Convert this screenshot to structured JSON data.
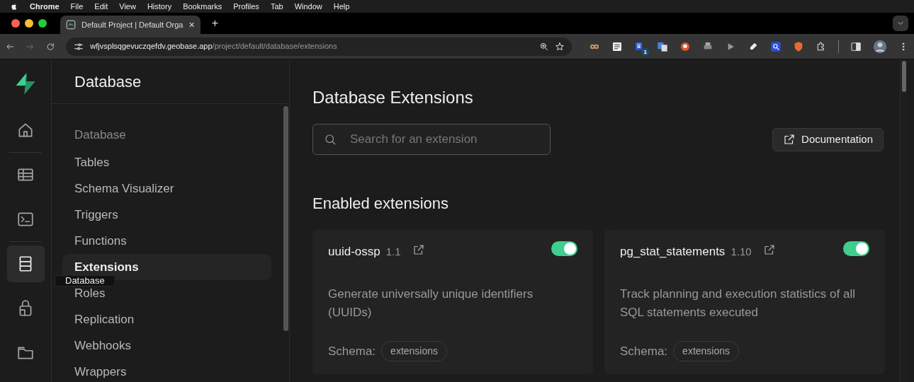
{
  "menu_bar": {
    "app": "Chrome",
    "items": [
      "File",
      "Edit",
      "View",
      "History",
      "Bookmarks",
      "Profiles",
      "Tab",
      "Window",
      "Help"
    ]
  },
  "browser": {
    "tab_title": "Default Project | Default Orga",
    "tab_close": "×",
    "new_tab": "+",
    "url_host": "wfjvsplsqgevuczqefdv.geobase.app",
    "url_path": "/project/default/database/extensions",
    "extension_badge": "1"
  },
  "rail": {
    "items": [
      {
        "kind": "home",
        "selected": false
      },
      {
        "kind": "table",
        "selected": false
      },
      {
        "kind": "terminal",
        "selected": false
      },
      {
        "kind": "database",
        "selected": true
      },
      {
        "kind": "lock",
        "selected": false
      },
      {
        "kind": "folder",
        "selected": false
      }
    ],
    "tooltip": "Database"
  },
  "sidebar": {
    "title": "Database",
    "group": "Database",
    "items": [
      {
        "label": "Tables",
        "selected": false
      },
      {
        "label": "Schema Visualizer",
        "selected": false
      },
      {
        "label": "Triggers",
        "selected": false
      },
      {
        "label": "Functions",
        "selected": false
      },
      {
        "label": "Extensions",
        "selected": true
      },
      {
        "label": "Roles",
        "selected": false
      },
      {
        "label": "Replication",
        "selected": false
      },
      {
        "label": "Webhooks",
        "selected": false
      },
      {
        "label": "Wrappers",
        "selected": false
      }
    ]
  },
  "main": {
    "title": "Database Extensions",
    "search": {
      "placeholder": "Search for an extension"
    },
    "documentation_button": "Documentation",
    "section_title": "Enabled extensions",
    "extensions": [
      {
        "name": "uuid-ossp",
        "version": "1.1",
        "on": true,
        "description": "Generate universally unique identifiers (UUIDs)",
        "schema_label": "Schema:",
        "schema": "extensions"
      },
      {
        "name": "pg_stat_statements",
        "version": "1.10",
        "on": true,
        "description": "Track planning and execution statistics of all SQL statements executed",
        "schema_label": "Schema:",
        "schema": "extensions"
      }
    ]
  }
}
